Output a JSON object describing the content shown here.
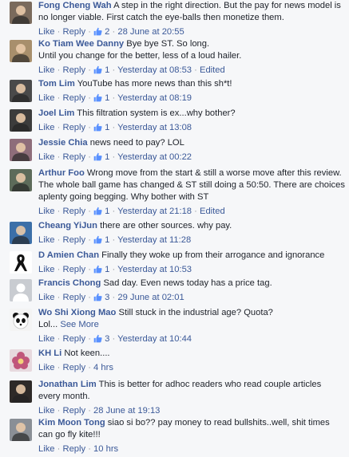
{
  "ui": {
    "like_label": "Like",
    "reply_label": "Reply",
    "edited_label": "Edited",
    "see_more_label": "See More"
  },
  "comments": [
    {
      "author": "Fong Cheng Wah",
      "text": "A step in the right direction. But the pay for news model is no longer viable. First catch the eye-balls then monetize them.",
      "likes": "2",
      "time": "28 June at 20:55",
      "edited": false,
      "avatar_icon": "user-photo-avatar",
      "avatar_color": "#7a6a5c"
    },
    {
      "author": "Ko Tiam Wee Danny",
      "text": "Bye bye ST. So long.\nUntil you change for the better, less of a loud hailer.",
      "likes": "1",
      "time": "Yesterday at 08:53",
      "edited": true,
      "avatar_icon": "user-photo-avatar",
      "avatar_color": "#a88f6c"
    },
    {
      "author": "Tom Lim",
      "text": "YouTube has more news than this sh*t!",
      "likes": "1",
      "time": "Yesterday at 08:19",
      "edited": false,
      "avatar_icon": "user-photo-avatar",
      "avatar_color": "#4a4a4a"
    },
    {
      "author": "Joel Lim",
      "text": "This filtration system is ex...why bother?",
      "likes": "1",
      "time": "Yesterday at 13:08",
      "edited": false,
      "avatar_icon": "user-photo-avatar",
      "avatar_color": "#3c3c3c"
    },
    {
      "author": "Jessie Chia",
      "text": "news need to pay? LOL",
      "likes": "1",
      "time": "Yesterday at 00:22",
      "edited": false,
      "avatar_icon": "user-photo-avatar",
      "avatar_color": "#8e6d7a"
    },
    {
      "author": "Arthur Foo",
      "text": "Wrong move from the start & still a worse move after this review. The whole ball game has changed & ST still doing a 50:50. There are choices aplenty going begging. Why bother with ST",
      "likes": "1",
      "time": "Yesterday at 21:18",
      "edited": true,
      "avatar_icon": "user-photo-avatar",
      "avatar_color": "#5d6b5a"
    },
    {
      "author": "Cheang YiJun",
      "text": "there are other sources. why pay.",
      "likes": "1",
      "time": "Yesterday at 11:28",
      "edited": false,
      "avatar_icon": "user-photo-avatar",
      "avatar_color": "#3c6fa8"
    },
    {
      "author": "D Amien Chan",
      "text": "Finally they woke up from their arrogance and ignorance",
      "likes": "1",
      "time": "Yesterday at 10:53",
      "edited": false,
      "avatar_icon": "black-ribbon-avatar",
      "avatar_color": "#ffffff"
    },
    {
      "author": "Francis Chong",
      "text": "Sad day. Even news today has a price tag.",
      "likes": "3",
      "time": "29 June at 02:01",
      "edited": false,
      "avatar_icon": "default-silhouette-avatar",
      "avatar_color": "#c9ccd1"
    },
    {
      "author": "Wo Shi Xiong Mao",
      "text": "Still stuck in the industrial age? Quota?\nLol...",
      "see_more": true,
      "likes": "3",
      "time": "Yesterday at 10:44",
      "edited": false,
      "avatar_icon": "panda-avatar",
      "avatar_color": "#e8e8e8"
    },
    {
      "author": "KH Li",
      "text": "Not keen....",
      "likes": "",
      "time": "4 hrs",
      "edited": false,
      "avatar_icon": "flower-avatar",
      "avatar_color": "#c0567a"
    },
    {
      "author": "Jonathan Lim",
      "text": "This is better for adhoc readers who read couple articles every month.",
      "likes": "",
      "time": "28 June at 19:13",
      "edited": false,
      "avatar_icon": "user-photo-avatar",
      "avatar_color": "#2e2a28"
    },
    {
      "author": "Kim Moon Tong",
      "text": "siao si bo?? pay money to read bullshits..well, shit times can go fly kite!!!",
      "likes": "",
      "time": "10 hrs",
      "edited": false,
      "avatar_icon": "user-photo-avatar",
      "avatar_color": "#8a8f96"
    }
  ]
}
